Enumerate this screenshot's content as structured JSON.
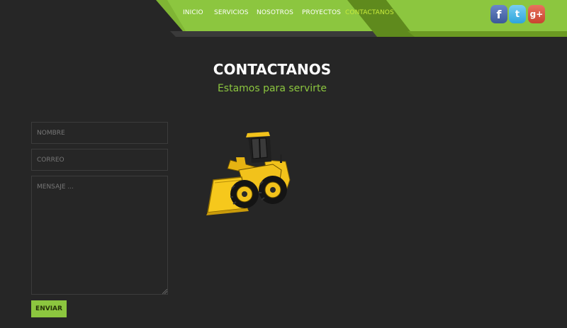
{
  "nav": {
    "items": [
      {
        "label": "INICIO",
        "active": false
      },
      {
        "label": "SERVICIOS",
        "active": false
      },
      {
        "label": "NOSOTROS",
        "active": false
      },
      {
        "label": "PROYECTOS",
        "active": false
      },
      {
        "label": "CONTACTANOS",
        "active": true
      }
    ],
    "colors": {
      "band": "#8cc63f",
      "active_tab": "#5f8a1d",
      "band_shadow": "#6b9a22",
      "active_text": "#c8ec3c"
    }
  },
  "social": {
    "facebook": {
      "icon": "facebook-icon",
      "glyph": "f"
    },
    "twitter": {
      "icon": "twitter-icon",
      "glyph": "t"
    },
    "google_plus": {
      "icon": "google-plus-icon",
      "glyph": "g+"
    }
  },
  "header": {
    "title": "CONTACTANOS",
    "subtitle": "Estamos para servirte"
  },
  "form": {
    "name_placeholder": "NOMBRE",
    "email_placeholder": "CORREO",
    "message_placeholder": "MENSAJE ...",
    "submit_label": "ENVIAR"
  },
  "illustration": {
    "icon": "wheel-loader-icon"
  },
  "colors": {
    "background": "#262626",
    "accent": "#8cc63f",
    "field_border": "#3c3c3c"
  }
}
